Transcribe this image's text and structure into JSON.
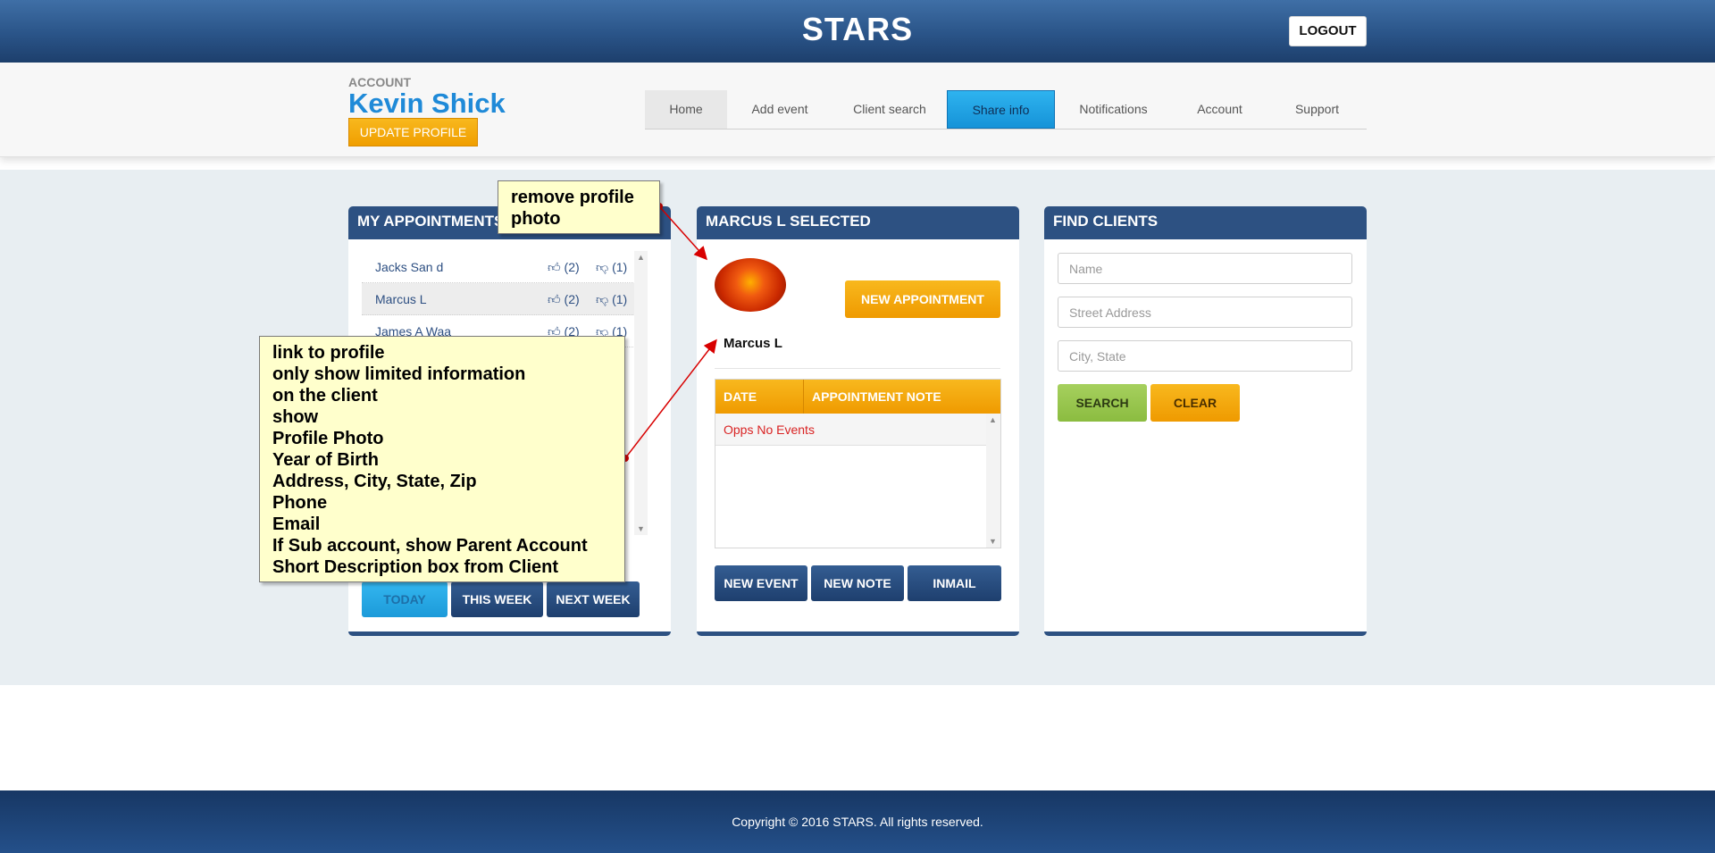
{
  "header": {
    "brand": "STARS",
    "logout_label": "LOGOUT",
    "account_label": "ACCOUNT",
    "account_name": "Kevin Shick",
    "update_profile_label": "UPDATE PROFILE"
  },
  "nav": {
    "items": [
      "Home",
      "Add event",
      "Client search",
      "Share info",
      "Notifications",
      "Account",
      "Support"
    ],
    "active": "Share info"
  },
  "appointments": {
    "title": "MY APPOINTMENTS",
    "rows": [
      {
        "name": "Jacks San d",
        "up": "(2)",
        "down": "(1)"
      },
      {
        "name": "Marcus L",
        "up": "(2)",
        "down": "(1)"
      },
      {
        "name": "James A Waa",
        "up": "(2)",
        "down": "(1)"
      }
    ],
    "today_label": "TODAY",
    "this_week_label": "THIS WEEK",
    "next_week_label": "NEXT WEEK"
  },
  "selected": {
    "title": "MARCUS L SELECTED",
    "new_appointment_label": "NEW APPOINTMENT",
    "client_name": "Marcus L",
    "col_date": "DATE",
    "col_note": "APPOINTMENT NOTE",
    "empty_text": "Opps No Events",
    "new_event_label": "NEW EVENT",
    "new_note_label": "NEW NOTE",
    "inmail_label": "INMAIL"
  },
  "find": {
    "title": "FIND CLIENTS",
    "name_placeholder": "Name",
    "street_placeholder": "Street Address",
    "city_placeholder": "City, State",
    "search_label": "SEARCH",
    "clear_label": "CLEAR"
  },
  "annotations": {
    "remove_photo": [
      "remove profile",
      "photo"
    ],
    "profile_info": [
      "link to profile",
      "only show limited information",
      "on the client",
      "show",
      "Profile Photo",
      "Year of Birth",
      "Address, City, State, Zip",
      "Phone",
      "Email",
      "If Sub account, show Parent Account",
      "Short Description box from Client"
    ]
  },
  "footer": {
    "copyright": "Copyright © 2016 STARS. All rights reserved."
  },
  "colors": {
    "brand_blue": "#2d5182",
    "accent_orange": "#f0a00a",
    "active_tab": "#1d9ee0",
    "note_bg": "#ffffcc",
    "error_red": "#d92323"
  }
}
